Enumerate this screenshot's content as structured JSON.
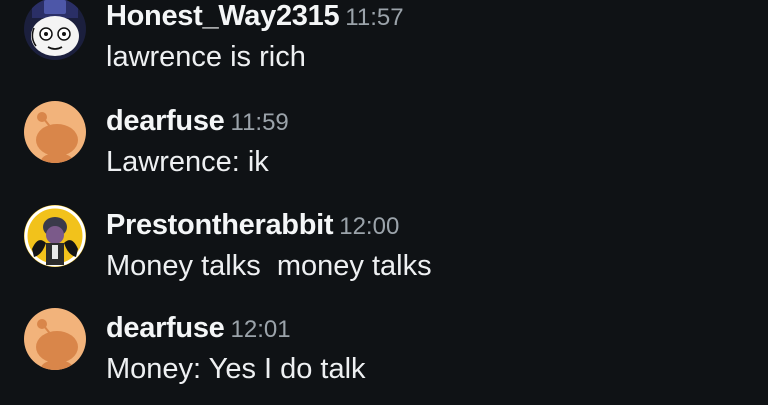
{
  "messages": [
    {
      "username": "Honest_Way2315",
      "time": "11:57",
      "text": "lawrence is rich",
      "avatar_icon": "cartoon-user-avatar-icon"
    },
    {
      "username": "dearfuse",
      "time": "11:59",
      "text": "Lawrence: ik",
      "avatar_icon": "reddit-snoo-avatar-icon"
    },
    {
      "username": "Prestontherabbit",
      "time": "12:00",
      "text": "Money talks  money talks",
      "avatar_icon": "character-avatar-icon"
    },
    {
      "username": "dearfuse",
      "time": "12:01",
      "text": "Money: Yes I do talk",
      "avatar_icon": "reddit-snoo-avatar-icon"
    }
  ],
  "colors": {
    "background": "#0f1215",
    "username": "#f4f6f7",
    "timestamp": "#9ba3aa",
    "snoo_avatar_bg": "#f2b37b",
    "snoo_face": "#d9864a"
  }
}
